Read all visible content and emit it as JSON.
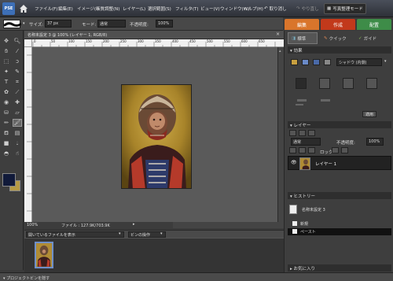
{
  "app": {
    "logo": "PSE",
    "menu": [
      "ファイル(F)",
      "編集(E)",
      "イメージ(I)",
      "画質調整(N)",
      "レイヤー(L)",
      "選択範囲(S)",
      "フィルタ(T)",
      "ビュー(V)",
      "ウィンドウ(W)",
      "ヘルプ(H)"
    ],
    "undo_label": "取り消し",
    "redo_label": "やり直し",
    "photo_mode_label": "写真整理モード"
  },
  "options": {
    "size_label": "サイズ:",
    "size_value": "37 px",
    "mode_label": "モード:",
    "mode_value": "通常",
    "opacity_label": "不透明度:",
    "opacity_value": "100%"
  },
  "mode_tabs": [
    {
      "label": "編集",
      "color": "#d9752b"
    },
    {
      "label": "作成",
      "color": "#c2391b"
    },
    {
      "label": "配置",
      "color": "#3e8c48"
    }
  ],
  "palette_tabs": [
    "標準",
    "クイック",
    "ガイド"
  ],
  "document": {
    "title": "名称未設定 3 @ 100% (レイヤー 1, RGB/8)",
    "close": "×",
    "zoom": "100%",
    "file_info": "ファイル : 127.9K/703.9K"
  },
  "ruler_labels": [
    "0",
    "50",
    "100",
    "150",
    "200",
    "250",
    "300",
    "350",
    "400",
    "450",
    "500",
    "550",
    "600",
    "650"
  ],
  "effects": {
    "title": "効果",
    "dropdown": "シャドウ (内側)",
    "apply_label": "適用"
  },
  "layers": {
    "title": "レイヤー",
    "blend_mode": "通常",
    "opacity_label": "不透明度:",
    "opacity_value": "100%",
    "lock_label": "ロック",
    "layer_name": "レイヤー 1"
  },
  "history": {
    "title": "ヒストリー",
    "snapshot": "名称未設定 3",
    "items": [
      "新規",
      "ペースト"
    ]
  },
  "favorites_title": "お気に入り",
  "bin": {
    "dropdown": "開いているファイルを表示",
    "actions": "ビンの操作"
  },
  "bottom_bar": "プロジェクトビンを隠す",
  "colors": {
    "foreground": "#111a3a",
    "background": "#b59a45",
    "accent": "#3d6fb7"
  }
}
